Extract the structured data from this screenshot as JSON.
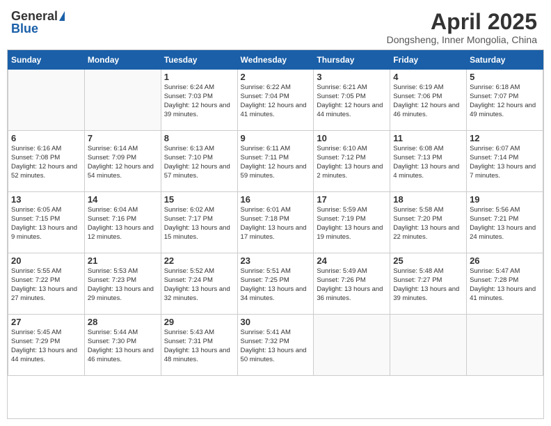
{
  "header": {
    "logo_general": "General",
    "logo_blue": "Blue",
    "title": "April 2025",
    "location": "Dongsheng, Inner Mongolia, China"
  },
  "days_of_week": [
    "Sunday",
    "Monday",
    "Tuesday",
    "Wednesday",
    "Thursday",
    "Friday",
    "Saturday"
  ],
  "weeks": [
    [
      {
        "day": null
      },
      {
        "day": null
      },
      {
        "day": 1,
        "sunrise": "Sunrise: 6:24 AM",
        "sunset": "Sunset: 7:03 PM",
        "daylight": "Daylight: 12 hours and 39 minutes."
      },
      {
        "day": 2,
        "sunrise": "Sunrise: 6:22 AM",
        "sunset": "Sunset: 7:04 PM",
        "daylight": "Daylight: 12 hours and 41 minutes."
      },
      {
        "day": 3,
        "sunrise": "Sunrise: 6:21 AM",
        "sunset": "Sunset: 7:05 PM",
        "daylight": "Daylight: 12 hours and 44 minutes."
      },
      {
        "day": 4,
        "sunrise": "Sunrise: 6:19 AM",
        "sunset": "Sunset: 7:06 PM",
        "daylight": "Daylight: 12 hours and 46 minutes."
      },
      {
        "day": 5,
        "sunrise": "Sunrise: 6:18 AM",
        "sunset": "Sunset: 7:07 PM",
        "daylight": "Daylight: 12 hours and 49 minutes."
      }
    ],
    [
      {
        "day": 6,
        "sunrise": "Sunrise: 6:16 AM",
        "sunset": "Sunset: 7:08 PM",
        "daylight": "Daylight: 12 hours and 52 minutes."
      },
      {
        "day": 7,
        "sunrise": "Sunrise: 6:14 AM",
        "sunset": "Sunset: 7:09 PM",
        "daylight": "Daylight: 12 hours and 54 minutes."
      },
      {
        "day": 8,
        "sunrise": "Sunrise: 6:13 AM",
        "sunset": "Sunset: 7:10 PM",
        "daylight": "Daylight: 12 hours and 57 minutes."
      },
      {
        "day": 9,
        "sunrise": "Sunrise: 6:11 AM",
        "sunset": "Sunset: 7:11 PM",
        "daylight": "Daylight: 12 hours and 59 minutes."
      },
      {
        "day": 10,
        "sunrise": "Sunrise: 6:10 AM",
        "sunset": "Sunset: 7:12 PM",
        "daylight": "Daylight: 13 hours and 2 minutes."
      },
      {
        "day": 11,
        "sunrise": "Sunrise: 6:08 AM",
        "sunset": "Sunset: 7:13 PM",
        "daylight": "Daylight: 13 hours and 4 minutes."
      },
      {
        "day": 12,
        "sunrise": "Sunrise: 6:07 AM",
        "sunset": "Sunset: 7:14 PM",
        "daylight": "Daylight: 13 hours and 7 minutes."
      }
    ],
    [
      {
        "day": 13,
        "sunrise": "Sunrise: 6:05 AM",
        "sunset": "Sunset: 7:15 PM",
        "daylight": "Daylight: 13 hours and 9 minutes."
      },
      {
        "day": 14,
        "sunrise": "Sunrise: 6:04 AM",
        "sunset": "Sunset: 7:16 PM",
        "daylight": "Daylight: 13 hours and 12 minutes."
      },
      {
        "day": 15,
        "sunrise": "Sunrise: 6:02 AM",
        "sunset": "Sunset: 7:17 PM",
        "daylight": "Daylight: 13 hours and 15 minutes."
      },
      {
        "day": 16,
        "sunrise": "Sunrise: 6:01 AM",
        "sunset": "Sunset: 7:18 PM",
        "daylight": "Daylight: 13 hours and 17 minutes."
      },
      {
        "day": 17,
        "sunrise": "Sunrise: 5:59 AM",
        "sunset": "Sunset: 7:19 PM",
        "daylight": "Daylight: 13 hours and 19 minutes."
      },
      {
        "day": 18,
        "sunrise": "Sunrise: 5:58 AM",
        "sunset": "Sunset: 7:20 PM",
        "daylight": "Daylight: 13 hours and 22 minutes."
      },
      {
        "day": 19,
        "sunrise": "Sunrise: 5:56 AM",
        "sunset": "Sunset: 7:21 PM",
        "daylight": "Daylight: 13 hours and 24 minutes."
      }
    ],
    [
      {
        "day": 20,
        "sunrise": "Sunrise: 5:55 AM",
        "sunset": "Sunset: 7:22 PM",
        "daylight": "Daylight: 13 hours and 27 minutes."
      },
      {
        "day": 21,
        "sunrise": "Sunrise: 5:53 AM",
        "sunset": "Sunset: 7:23 PM",
        "daylight": "Daylight: 13 hours and 29 minutes."
      },
      {
        "day": 22,
        "sunrise": "Sunrise: 5:52 AM",
        "sunset": "Sunset: 7:24 PM",
        "daylight": "Daylight: 13 hours and 32 minutes."
      },
      {
        "day": 23,
        "sunrise": "Sunrise: 5:51 AM",
        "sunset": "Sunset: 7:25 PM",
        "daylight": "Daylight: 13 hours and 34 minutes."
      },
      {
        "day": 24,
        "sunrise": "Sunrise: 5:49 AM",
        "sunset": "Sunset: 7:26 PM",
        "daylight": "Daylight: 13 hours and 36 minutes."
      },
      {
        "day": 25,
        "sunrise": "Sunrise: 5:48 AM",
        "sunset": "Sunset: 7:27 PM",
        "daylight": "Daylight: 13 hours and 39 minutes."
      },
      {
        "day": 26,
        "sunrise": "Sunrise: 5:47 AM",
        "sunset": "Sunset: 7:28 PM",
        "daylight": "Daylight: 13 hours and 41 minutes."
      }
    ],
    [
      {
        "day": 27,
        "sunrise": "Sunrise: 5:45 AM",
        "sunset": "Sunset: 7:29 PM",
        "daylight": "Daylight: 13 hours and 44 minutes."
      },
      {
        "day": 28,
        "sunrise": "Sunrise: 5:44 AM",
        "sunset": "Sunset: 7:30 PM",
        "daylight": "Daylight: 13 hours and 46 minutes."
      },
      {
        "day": 29,
        "sunrise": "Sunrise: 5:43 AM",
        "sunset": "Sunset: 7:31 PM",
        "daylight": "Daylight: 13 hours and 48 minutes."
      },
      {
        "day": 30,
        "sunrise": "Sunrise: 5:41 AM",
        "sunset": "Sunset: 7:32 PM",
        "daylight": "Daylight: 13 hours and 50 minutes."
      },
      {
        "day": null
      },
      {
        "day": null
      },
      {
        "day": null
      }
    ]
  ]
}
